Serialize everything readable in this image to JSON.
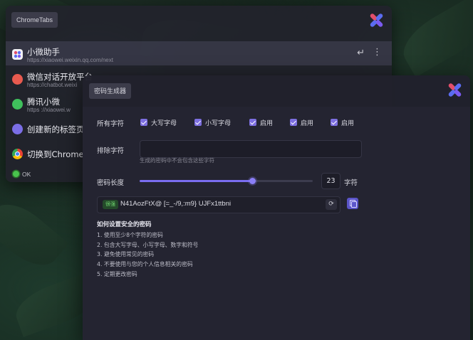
{
  "chrome_tabs": {
    "title": "ChromeTabs",
    "items": [
      {
        "title": "小微助手",
        "url": "https://xiaowei.weixin.qq.com/next",
        "icon": "xiaowei-assistant-icon",
        "active": true
      },
      {
        "title": "微信对话开放平台",
        "url": "https://chatbot.weixi",
        "icon": "wechat-dialog-platform-icon"
      },
      {
        "title": "腾讯小微",
        "url": "https ://xiaowei.w",
        "icon": "tencent-xiaowei-icon"
      },
      {
        "title": "创建新的标签页",
        "icon": "new-tab-icon"
      },
      {
        "title": "切换到Chrome",
        "icon": "chrome-icon"
      }
    ],
    "enter_glyph": "↵",
    "more_glyph": "⋮",
    "status": "OK",
    "colors": {
      "status_ok": "#49c24d"
    }
  },
  "password_generator": {
    "title": "密码生成器",
    "all_chars_label": "所有字符",
    "options": [
      {
        "label": "大写字母",
        "checked": true
      },
      {
        "label": "小写字母",
        "checked": true
      },
      {
        "label": "启用",
        "checked": true
      },
      {
        "label": "启用",
        "checked": true
      },
      {
        "label": "启用",
        "checked": true
      }
    ],
    "exclude_label": "排除字符",
    "exclude_value": "",
    "exclude_hint": "生成的密码中不会包含这些字符",
    "length_label": "密码长度",
    "length_value": "23",
    "length_unit": "字符",
    "length_fraction": 0.65,
    "strength_badge": "很强",
    "password": "N41AozFtX@ [=_-/9,:m9} UJFx1ttbni",
    "refresh_glyph": "⟳",
    "tips_title": "如何设置安全的密码",
    "tips": [
      "1. 使用至少8个字符的密码",
      "2. 包含大写字母、小写字母、数字和符号",
      "3. 避免使用常见的密码",
      "4. 不要使用与您的个人信息相关的密码",
      "5. 定期更改密码"
    ],
    "colors": {
      "accent": "#7d6fe0",
      "strength": "#6fd36f"
    }
  }
}
